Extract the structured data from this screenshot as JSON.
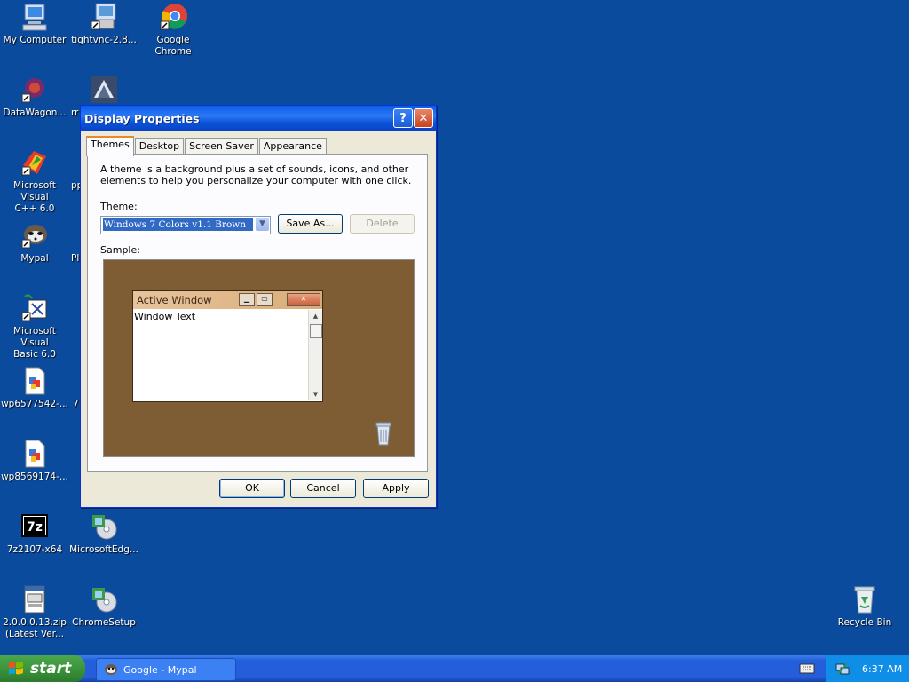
{
  "desktop": {
    "icons": [
      {
        "name": "my-computer",
        "label": "My Computer"
      },
      {
        "name": "tightvnc",
        "label": "tightvnc-2.8..."
      },
      {
        "name": "google-chrome",
        "label": "Google Chrome"
      },
      {
        "name": "datawagon",
        "label": "DataWagon..."
      },
      {
        "name": "msvc",
        "label": "Microsoft Visual\nC++ 6.0"
      },
      {
        "name": "mypal",
        "label": "Mypal"
      },
      {
        "name": "msvb",
        "label": "Microsoft Visual\nBasic 6.0"
      },
      {
        "name": "wp1",
        "label": "wp6577542-..."
      },
      {
        "name": "wp2",
        "label": "wp8569174-..."
      },
      {
        "name": "7z",
        "label": "7z2107-x64"
      },
      {
        "name": "msedge",
        "label": "MicrosoftEdg..."
      },
      {
        "name": "zip",
        "label": "2.0.0.0.13.zip\n(Latest Ver..."
      },
      {
        "name": "chromesetup",
        "label": "ChromeSetup"
      },
      {
        "name": "recycle-bin",
        "label": "Recycle Bin"
      }
    ],
    "partial": {
      "p1": "rr",
      "p2": "pp",
      "p3": "Pl",
      "p4": "7"
    }
  },
  "window": {
    "title": "Display Properties",
    "help": "?",
    "close": "✕",
    "tabs": [
      "Themes",
      "Desktop",
      "Screen Saver",
      "Appearance"
    ],
    "description": "A theme is a background plus a set of sounds, icons, and other elements to help you personalize your computer with one click.",
    "theme_label": "Theme:",
    "theme_value": "Windows 7 Colors v1.1 Brown",
    "save_as": "Save As...",
    "delete": "Delete",
    "sample_label": "Sample:",
    "sample": {
      "window_title": "Active Window",
      "window_text": "Window Text"
    },
    "ok": "OK",
    "cancel": "Cancel",
    "apply": "Apply"
  },
  "taskbar": {
    "start": "start",
    "task": "Google - Mypal",
    "time": "6:37 AM"
  }
}
